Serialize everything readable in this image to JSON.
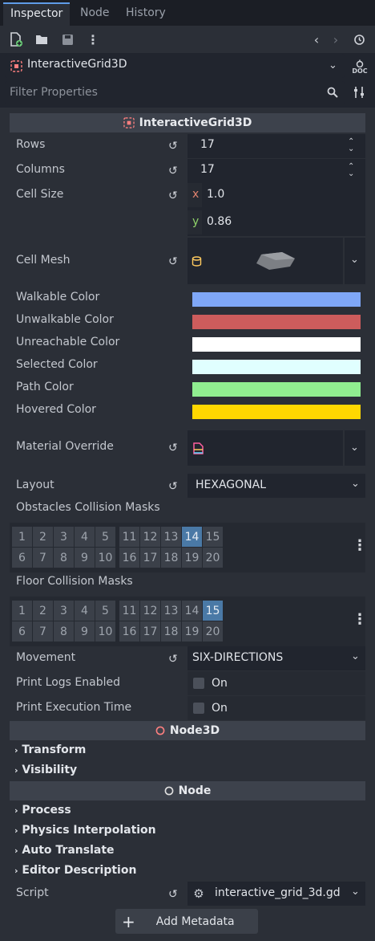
{
  "tabs": [
    "Inspector",
    "Node",
    "History"
  ],
  "toolbar": {
    "icons": [
      "new-resource-icon",
      "open-folder-icon",
      "save-icon",
      "kebab-menu-icon",
      "back-icon",
      "forward-icon",
      "history-icon"
    ],
    "doc_label": "DOC"
  },
  "node_selector": {
    "name": "InteractiveGrid3D"
  },
  "filter": {
    "placeholder": "Filter Properties"
  },
  "section_main": {
    "title": "InteractiveGrid3D"
  },
  "props": {
    "rows": {
      "label": "Rows",
      "value": "17"
    },
    "columns": {
      "label": "Columns",
      "value": "17"
    },
    "cell_size": {
      "label": "Cell Size",
      "x_label": "x",
      "x": "1.0",
      "y_label": "y",
      "y": "0.86"
    },
    "cell_mesh": {
      "label": "Cell Mesh"
    },
    "walkable": {
      "label": "Walkable Color",
      "color": "#7fa7f7"
    },
    "unwalkable": {
      "label": "Unwalkable Color",
      "color": "#cd5c5c"
    },
    "unreachable": {
      "label": "Unreachable Color",
      "color": "#ffffff"
    },
    "selected": {
      "label": "Selected Color",
      "color": "#e0ffff"
    },
    "path": {
      "label": "Path Color",
      "color": "#90ee90"
    },
    "hovered": {
      "label": "Hovered Color",
      "color": "#ffd700"
    },
    "material_override": {
      "label": "Material Override"
    },
    "layout": {
      "label": "Layout",
      "value": "HEXAGONAL"
    },
    "obstacles_masks": {
      "label": "Obstacles Collision Masks",
      "row1": [
        "1",
        "2",
        "3",
        "4",
        "5",
        "11",
        "12",
        "13",
        "14",
        "15"
      ],
      "row2": [
        "6",
        "7",
        "8",
        "9",
        "10",
        "16",
        "17",
        "18",
        "19",
        "20"
      ],
      "active": [
        "14"
      ]
    },
    "floor_masks": {
      "label": "Floor Collision Masks",
      "row1": [
        "1",
        "2",
        "3",
        "4",
        "5",
        "11",
        "12",
        "13",
        "14",
        "15"
      ],
      "row2": [
        "6",
        "7",
        "8",
        "9",
        "10",
        "16",
        "17",
        "18",
        "19",
        "20"
      ],
      "active": [
        "15"
      ]
    },
    "movement": {
      "label": "Movement",
      "value": "SIX-DIRECTIONS"
    },
    "print_logs": {
      "label": "Print Logs Enabled",
      "value": "On"
    },
    "print_exec": {
      "label": "Print Execution Time",
      "value": "On"
    }
  },
  "section_node3d": {
    "title": "Node3D",
    "groups": [
      "Transform",
      "Visibility"
    ]
  },
  "section_node": {
    "title": "Node",
    "groups": [
      "Process",
      "Physics Interpolation",
      "Auto Translate",
      "Editor Description"
    ]
  },
  "script": {
    "label": "Script",
    "value": "interactive_grid_3d.gd"
  },
  "add_metadata": {
    "label": "Add Metadata"
  }
}
